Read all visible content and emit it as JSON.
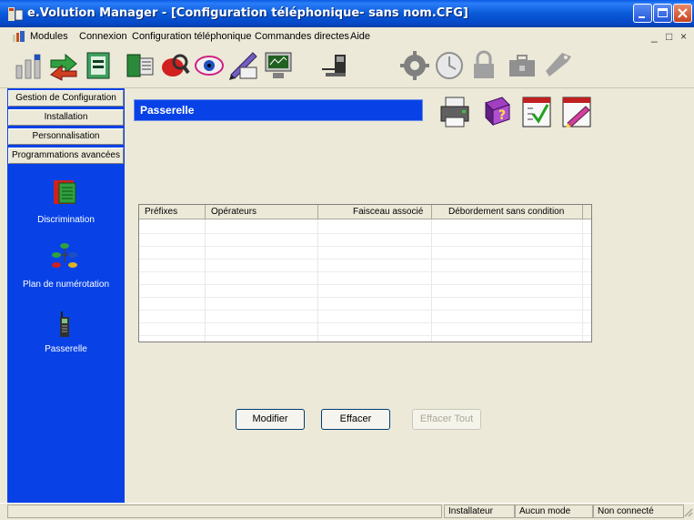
{
  "window": {
    "title": "e.Volution Manager - [Configuration téléphonique- sans nom.CFG]"
  },
  "menu": {
    "items": [
      "Modules",
      "Connexion",
      "Configuration téléphonique",
      "Commandes directes",
      "Aide"
    ],
    "mdi_controls": [
      "_",
      "□",
      "×"
    ]
  },
  "toolbar": {
    "icons": [
      "network-icon",
      "transfer-icon",
      "phone-book-icon",
      "configure-icon",
      "search-icon",
      "view-icon",
      "edit-icon",
      "monitor-icon",
      "connect-icon",
      "gear-icon",
      "clock-icon",
      "lock-icon",
      "toolbox-icon",
      "tag-icon"
    ]
  },
  "nav": {
    "tabs": [
      "Gestion de Configuration",
      "Installation",
      "Personnalisation",
      "Programmations avancées"
    ],
    "items": [
      {
        "label": "Discrimination",
        "icon": "book-icon"
      },
      {
        "label": "Plan de numérotation",
        "icon": "phone-tree-icon"
      },
      {
        "label": "Passerelle",
        "icon": "gateway-phone-icon"
      }
    ]
  },
  "main": {
    "title": "Passerelle",
    "header_icons": [
      "printer-icon",
      "help-icon",
      "validate-icon",
      "edit-note-icon"
    ],
    "table": {
      "columns": [
        "Préfixes",
        "Opérateurs",
        "Faisceau associé",
        "Débordement sans condition"
      ],
      "rows": []
    },
    "buttons": {
      "modify": "Modifier",
      "delete": "Effacer",
      "delete_all": "Effacer Tout"
    }
  },
  "status": {
    "user": "Installateur",
    "mode": "Aucun mode",
    "connection": "Non connecté"
  },
  "colors": {
    "title_bar": "#0a5ae4",
    "panel_blue": "#0842e6",
    "window_bg": "#ece9d8"
  }
}
